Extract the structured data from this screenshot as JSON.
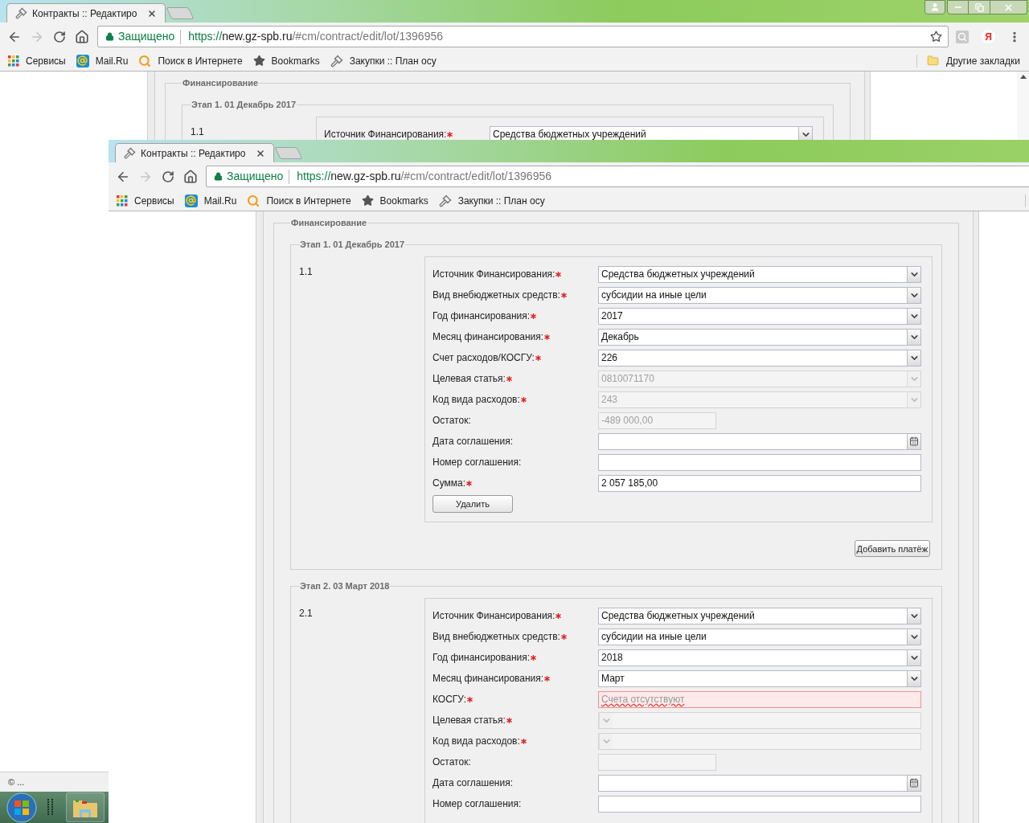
{
  "back_window": {
    "window_controls": true,
    "tab": {
      "title": "Контракты :: Редактиро"
    },
    "omnibox": {
      "security": "Защищено",
      "scheme": "https://",
      "host": "new.gz-spb.ru",
      "path": "/#cm/contract/edit/lot/1396956"
    },
    "yandex": "Я",
    "bookmarks": [
      {
        "kind": "apps",
        "label": "Сервисы"
      },
      {
        "kind": "mail",
        "label": "Mail.Ru"
      },
      {
        "kind": "search",
        "label": "Поиск в Интернете"
      },
      {
        "kind": "star",
        "label": "Bookmarks"
      },
      {
        "kind": "gavel",
        "label": "Закупки :: План осу"
      }
    ],
    "other_bookmarks": "Другие закладки",
    "page": {
      "section_legend": "Финансирование",
      "stages": [
        {
          "legend": "Этап 1. 01 Декабрь 2017",
          "items": [
            {
              "number": "1.1",
              "rows": [
                {
                  "label": "Источник Финансирования:",
                  "required": true,
                  "kind": "select",
                  "disabled": false,
                  "value": "Средства бюджетных учреждений"
                }
              ]
            }
          ]
        }
      ]
    },
    "status_bubble": "© ..."
  },
  "front_window": {
    "tab": {
      "title": "Контракты :: Редактиро"
    },
    "omnibox": {
      "security": "Защищено",
      "scheme": "https://",
      "host": "new.gz-spb.ru",
      "path": "/#cm/contract/edit/lot/1396956"
    },
    "bookmarks": [
      {
        "kind": "apps",
        "label": "Сервисы"
      },
      {
        "kind": "mail",
        "label": "Mail.Ru"
      },
      {
        "kind": "search",
        "label": "Поиск в Интернете"
      },
      {
        "kind": "star",
        "label": "Bookmarks"
      },
      {
        "kind": "gavel",
        "label": "Закупки :: План осу"
      }
    ],
    "page": {
      "section_legend": "Финансирование",
      "stages": [
        {
          "legend": "Этап 1. 01 Декабрь 2017",
          "add_button": "Добавить платёж",
          "items": [
            {
              "number": "1.1",
              "delete_button": "Удалить",
              "rows": [
                {
                  "label": "Источник Финансирования:",
                  "required": true,
                  "kind": "select",
                  "disabled": false,
                  "value": "Средства бюджетных учреждений"
                },
                {
                  "label": "Вид внебюджетных средств:",
                  "required": true,
                  "kind": "select",
                  "disabled": false,
                  "value": "субсидии на иные цели"
                },
                {
                  "label": "Год финансирования:",
                  "required": true,
                  "kind": "select",
                  "disabled": false,
                  "value": "2017"
                },
                {
                  "label": "Месяц финансирования:",
                  "required": true,
                  "kind": "select",
                  "disabled": false,
                  "value": "Декабрь"
                },
                {
                  "label": "Счет расходов/КОСГУ:",
                  "required": true,
                  "kind": "select",
                  "disabled": false,
                  "value": "226"
                },
                {
                  "label": "Целевая статья:",
                  "required": true,
                  "kind": "select",
                  "disabled": true,
                  "value": "0810071170"
                },
                {
                  "label": "Код вида расходов:",
                  "required": true,
                  "kind": "select",
                  "disabled": true,
                  "value": "243"
                },
                {
                  "label": "Остаток:",
                  "required": false,
                  "kind": "short",
                  "disabled": true,
                  "value": "-489 000,00"
                },
                {
                  "label": "Дата соглашения:",
                  "required": false,
                  "kind": "date",
                  "disabled": false
                },
                {
                  "label": "Номер соглашения:",
                  "required": false,
                  "kind": "input",
                  "disabled": false
                },
                {
                  "label": "Сумма:",
                  "required": true,
                  "kind": "input",
                  "disabled": false,
                  "value": "2 057 185,00"
                }
              ]
            }
          ]
        },
        {
          "legend": "Этап 2. 03 Март 2018",
          "items": [
            {
              "number": "2.1",
              "rows": [
                {
                  "label": "Источник Финансирования:",
                  "required": true,
                  "kind": "select",
                  "disabled": false,
                  "value": "Средства бюджетных учреждений"
                },
                {
                  "label": "Вид внебюджетных средств:",
                  "required": true,
                  "kind": "select",
                  "disabled": false,
                  "value": "субсидии на иные цели"
                },
                {
                  "label": "Год финансирования:",
                  "required": true,
                  "kind": "select",
                  "disabled": false,
                  "value": "2018"
                },
                {
                  "label": "Месяц финансирования:",
                  "required": true,
                  "kind": "select",
                  "disabled": false,
                  "value": "Март"
                },
                {
                  "label": "КОСГУ:",
                  "required": true,
                  "kind": "error",
                  "disabled": false,
                  "value": "Счета отсутствуют"
                },
                {
                  "label": "Целевая статья:",
                  "required": true,
                  "kind": "select",
                  "disabled": true
                },
                {
                  "label": "Код вида расходов:",
                  "required": true,
                  "kind": "select",
                  "disabled": true
                },
                {
                  "label": "Остаток:",
                  "required": false,
                  "kind": "short",
                  "disabled": true
                },
                {
                  "label": "Дата соглашения:",
                  "required": false,
                  "kind": "date",
                  "disabled": false
                },
                {
                  "label": "Номер соглашения:",
                  "required": false,
                  "kind": "input",
                  "disabled": false
                }
              ]
            }
          ]
        }
      ]
    }
  }
}
